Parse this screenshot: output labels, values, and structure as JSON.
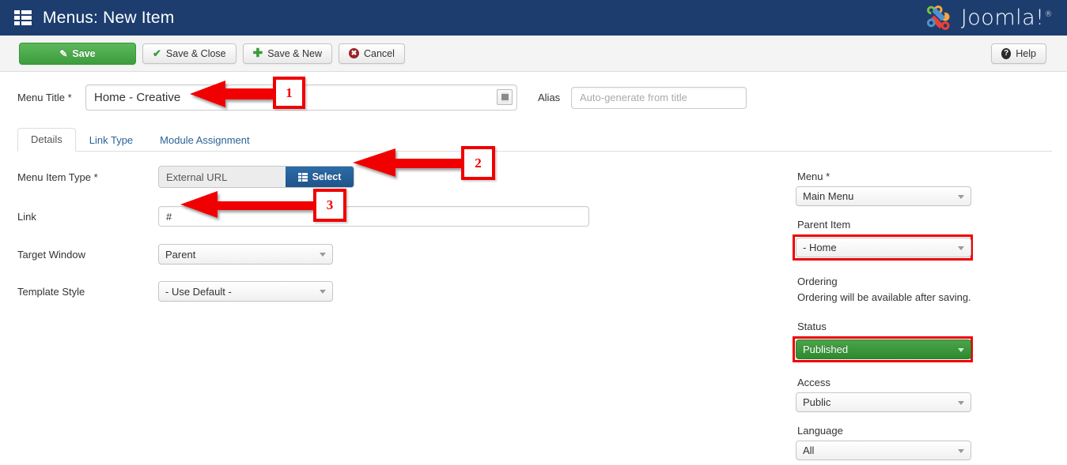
{
  "header": {
    "title": "Menus: New Item",
    "menu_icon": "grid-icon",
    "brand_name": "Joomla!",
    "brand_reg": "®"
  },
  "toolbar": {
    "save_label": "Save",
    "save_icon": "pencil-square-icon",
    "save_close_label": "Save & Close",
    "save_close_icon": "check-icon",
    "save_new_label": "Save & New",
    "save_new_icon": "plus-icon",
    "cancel_label": "Cancel",
    "cancel_icon": "cancel-circle-icon",
    "help_label": "Help",
    "help_icon": "question-circle-icon"
  },
  "title_row": {
    "menu_title_label": "Menu Title *",
    "menu_title_value": "Home - Creative",
    "menu_title_icon": "article-toggle-icon",
    "alias_label": "Alias",
    "alias_value": "",
    "alias_placeholder": "Auto-generate from title"
  },
  "tabs": [
    {
      "label": "Details",
      "active": true
    },
    {
      "label": "Link Type",
      "active": false
    },
    {
      "label": "Module Assignment",
      "active": false
    }
  ],
  "details": {
    "menu_item_type_label": "Menu Item Type *",
    "menu_item_type_value": "External URL",
    "select_button_label": "Select",
    "select_button_icon": "list-icon",
    "link_label": "Link",
    "link_value": "#",
    "target_window_label": "Target Window",
    "target_window_value": "Parent",
    "template_style_label": "Template Style",
    "template_style_value": "- Use Default -"
  },
  "sidebar": {
    "menu_label": "Menu *",
    "menu_value": "Main Menu",
    "parent_item_label": "Parent Item",
    "parent_item_value": "- Home",
    "ordering_label": "Ordering",
    "ordering_note": "Ordering will be available after saving.",
    "status_label": "Status",
    "status_value": "Published",
    "access_label": "Access",
    "access_value": "Public",
    "language_label": "Language",
    "language_value": "All"
  },
  "annotations": [
    {
      "number": "1"
    },
    {
      "number": "2"
    },
    {
      "number": "3"
    }
  ],
  "colors": {
    "header_blue": "#1c3d6e",
    "save_green": "#3d9c3d",
    "select_blue": "#1f548a",
    "status_green": "#2f8a2f",
    "annotation_red": "#f00000",
    "link_blue": "#2a6496"
  }
}
